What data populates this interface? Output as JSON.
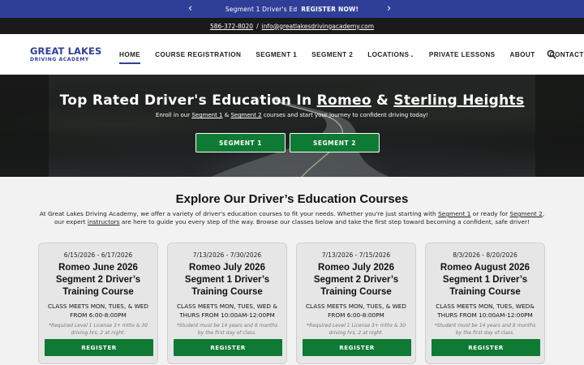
{
  "promo": {
    "text": "Segment 1 Driver's Ed",
    "cta": "REGISTER NOW!",
    "prev": "‹",
    "next": "›"
  },
  "contact": {
    "phone": "586-372-8020",
    "separator": "/",
    "email": "info@greatlakesdrivingacademy.com"
  },
  "logo": {
    "line1": "GREAT LAKES",
    "line2": "DRIVING ACADEMY"
  },
  "nav": {
    "items": [
      {
        "label": "HOME"
      },
      {
        "label": "COURSE REGISTRATION"
      },
      {
        "label": "SEGMENT 1"
      },
      {
        "label": "SEGMENT 2"
      },
      {
        "label": "LOCATIONS"
      },
      {
        "label": "PRIVATE LESSONS"
      },
      {
        "label": "ABOUT"
      },
      {
        "label": "CONTACT"
      }
    ],
    "dropdown_glyph": "⌄",
    "search_icon": "search-icon"
  },
  "hero": {
    "title_prefix": "Top Rated Driver's Education In ",
    "title_loc1": "Romeo",
    "title_amp": " & ",
    "title_loc2": "Sterling Heights",
    "sub_prefix": "Enroll in our ",
    "sub_link1": "Segment 1",
    "sub_mid": " & ",
    "sub_link2": "Segment 2",
    "sub_suffix": " courses and start your journey to confident driving today!",
    "btn1": "SEGMENT 1",
    "btn2": "SEGMENT 2"
  },
  "courses": {
    "title": "Explore Our Driver’s Education Courses",
    "intro_a": "At Great Lakes Driving Academy, we offer a variety of driver's education courses to fit your needs. Whether you're just starting with ",
    "intro_link1": "Segment 1",
    "intro_b": " or ready for ",
    "intro_link2": "Segment 2",
    "intro_c": ",",
    "intro_d": "our expert ",
    "intro_link3": "instructors",
    "intro_e": " are here to guide you every step of the way. Browse our classes below and take the first step toward becoming a confident, safe driver!",
    "cards": [
      {
        "date": "6/15/2026 - 6/17/2026",
        "title": "Romeo June 2026 Segment 2 Driver’s Training Course",
        "meets": "CLASS MEETS MON, TUES, & WED FROM 6:00-8:00PM",
        "note": "*Required Level 1 License 3+ mths & 30 driving hrs, 2 at night.",
        "button": "REGISTER"
      },
      {
        "date": "7/13/2026 - 7/30/2026",
        "title": "Romeo July 2026 Segment 1 Driver’s Training Course",
        "meets": "CLASS MEETS MON, TUES, WED & THURS FROM 10:00AM-12:00PM",
        "note": "*Student must be 14 years and 8 months by the first day of class.",
        "button": "REGISTER"
      },
      {
        "date": "7/13/2026 - 7/15/2026",
        "title": "Romeo July 2026 Segment 2 Driver’s Training Course",
        "meets": "CLASS MEETS MON, TUES, & WED FROM 6:00-8:00PM",
        "note": "*Required Level 1 License 3+ mths & 30 driving hrs, 2 at night.",
        "button": "REGISTER"
      },
      {
        "date": "8/3/2026 - 8/20/2026",
        "title": "Romeo August 2026 Segment 1 Driver’s Training Course",
        "meets": "CLASS MEETS MON, TUES, WED& THURS FROM 10:00AM-12:00PM",
        "note": "*Student must be 14 years and 8 months by the first day of class.",
        "button": "REGISTER"
      }
    ]
  },
  "colors": {
    "brand_blue": "#2f3f98",
    "cta_green": "#0f7a34",
    "topbar_dark": "#1a1a1a"
  }
}
